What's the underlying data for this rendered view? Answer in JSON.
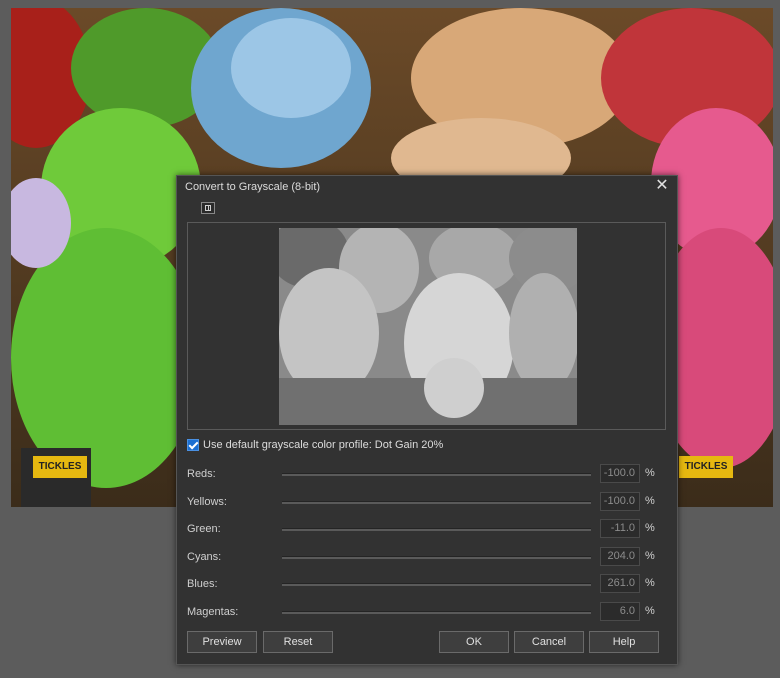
{
  "dialog": {
    "title": "Convert to Grayscale (8-bit)",
    "close_icon": "close-icon",
    "preview_toggle_icon": "split-view-icon",
    "use_profile_checked": true,
    "use_profile_label": "Use default grayscale color profile: Dot Gain 20%",
    "sliders": [
      {
        "label": "Reds:",
        "value": "-100.0",
        "unit": "%"
      },
      {
        "label": "Yellows:",
        "value": "-100.0",
        "unit": "%"
      },
      {
        "label": "Green:",
        "value": "-11.0",
        "unit": "%"
      },
      {
        "label": "Cyans:",
        "value": "204.0",
        "unit": "%"
      },
      {
        "label": "Blues:",
        "value": "261.0",
        "unit": "%"
      },
      {
        "label": "Magentas:",
        "value": "6.0",
        "unit": "%"
      }
    ],
    "buttons": {
      "preview": "Preview",
      "reset": "Reset",
      "ok": "OK",
      "cancel": "Cancel",
      "help": "Help"
    }
  },
  "background": {
    "sign_left": "TICKLES",
    "sign_right": "TICKLES"
  }
}
